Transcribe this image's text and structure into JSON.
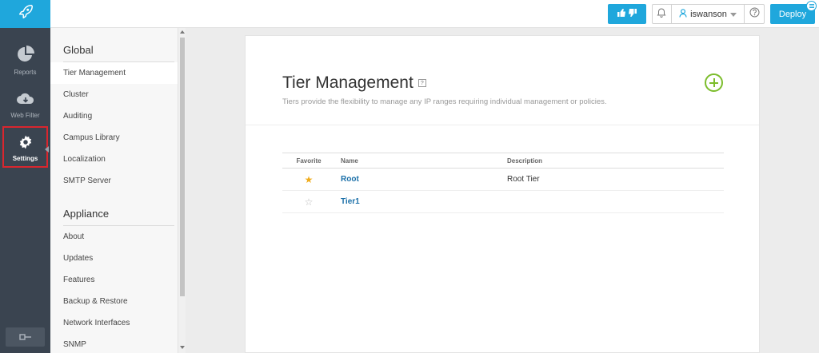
{
  "rail": {
    "items": [
      {
        "label": "Reports",
        "icon": "pie-chart-icon"
      },
      {
        "label": "Web Filter",
        "icon": "cloud-download-icon"
      },
      {
        "label": "Settings",
        "icon": "gear-icon",
        "active": true
      }
    ],
    "accent_color": "#1fa7dc",
    "highlight_color": "#d9262e"
  },
  "topbar": {
    "username": "iswanson",
    "deploy_label": "Deploy"
  },
  "subnav": {
    "sections": [
      {
        "title": "Global",
        "items": [
          "Tier Management",
          "Cluster",
          "Auditing",
          "Campus Library",
          "Localization",
          "SMTP Server"
        ]
      },
      {
        "title": "Appliance",
        "items": [
          "About",
          "Updates",
          "Features",
          "Backup & Restore",
          "Network Interfaces",
          "SNMP"
        ]
      }
    ],
    "active_item": "Tier Management"
  },
  "main": {
    "title": "Tier Management",
    "help_glyph": "?",
    "subtitle": "Tiers provide the flexibility to manage any IP ranges requiring individual management or policies.",
    "table": {
      "headers": {
        "favorite": "Favorite",
        "name": "Name",
        "description": "Description"
      },
      "rows": [
        {
          "favorite": true,
          "name": "Root",
          "description": "Root Tier"
        },
        {
          "favorite": false,
          "name": "Tier1",
          "description": ""
        }
      ]
    }
  }
}
